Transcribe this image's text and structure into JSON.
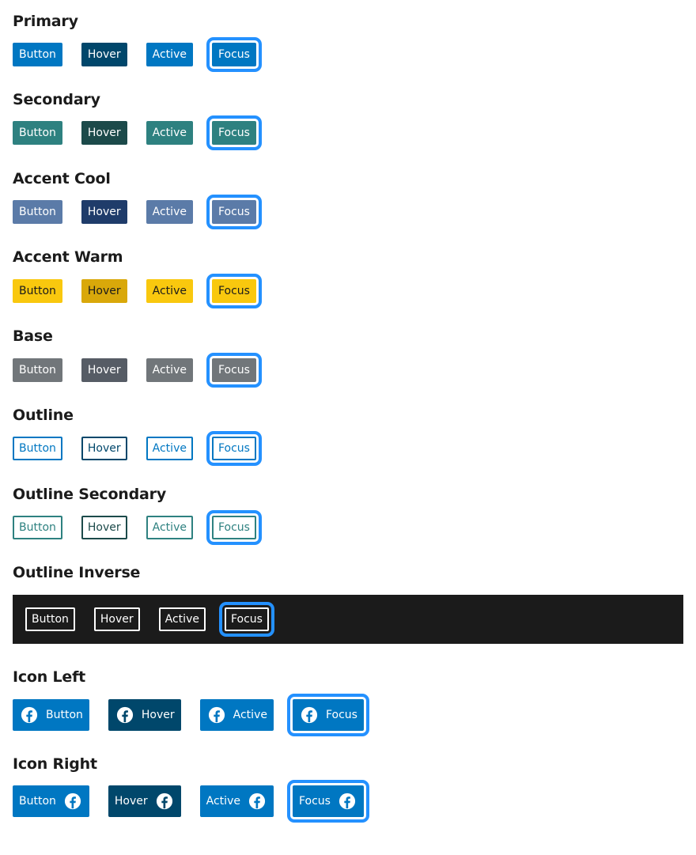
{
  "colors": {
    "primary": "#005ea2",
    "primary_btn": "#0077c2",
    "primary_hover": "#00476b",
    "secondary": "#2e8180",
    "secondary_hover": "#1c4a4a",
    "accent_cool": "#5b7ba8",
    "accent_cool_hover": "#1f3c6a",
    "accent_warm": "#f9c80e",
    "accent_warm_hover": "#d9a80a",
    "base": "#71767a",
    "base_hover": "#565c65",
    "focus": "#2491ff",
    "inverse_bg": "#1b1b1b"
  },
  "sections": [
    {
      "title": "Primary",
      "buttons": [
        "Button",
        "Hover",
        "Active",
        "Focus"
      ]
    },
    {
      "title": "Secondary",
      "buttons": [
        "Button",
        "Hover",
        "Active",
        "Focus"
      ]
    },
    {
      "title": "Accent Cool",
      "buttons": [
        "Button",
        "Hover",
        "Active",
        "Focus"
      ]
    },
    {
      "title": "Accent Warm",
      "buttons": [
        "Button",
        "Hover",
        "Active",
        "Focus"
      ]
    },
    {
      "title": "Base",
      "buttons": [
        "Button",
        "Hover",
        "Active",
        "Focus"
      ]
    },
    {
      "title": "Outline",
      "buttons": [
        "Button",
        "Hover",
        "Active",
        "Focus"
      ]
    },
    {
      "title": "Outline Secondary",
      "buttons": [
        "Button",
        "Hover",
        "Active",
        "Focus"
      ]
    },
    {
      "title": "Outline Inverse",
      "buttons": [
        "Button",
        "Hover",
        "Active",
        "Focus"
      ]
    },
    {
      "title": "Icon Left",
      "buttons": [
        "Button",
        "Hover",
        "Active",
        "Focus"
      ],
      "icon": "facebook-icon"
    },
    {
      "title": "Icon Right",
      "buttons": [
        "Button",
        "Hover",
        "Active",
        "Focus"
      ],
      "icon": "facebook-icon"
    }
  ]
}
